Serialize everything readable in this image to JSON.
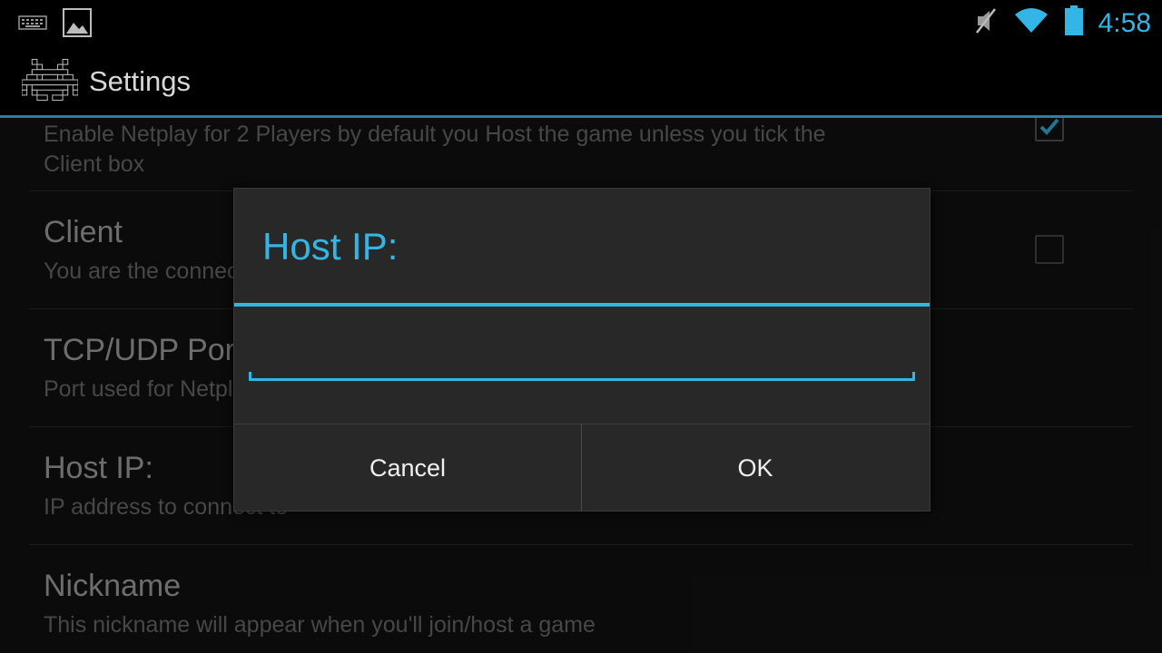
{
  "statusbar": {
    "time": "4:58",
    "icons": [
      "keyboard-icon",
      "image-icon",
      "mute-icon",
      "wifi-icon",
      "battery-icon"
    ]
  },
  "actionbar": {
    "title": "Settings",
    "app_icon": "space-invader-icon"
  },
  "preferences": [
    {
      "title": "",
      "summary": "Enable Netplay for 2 Players by default you Host the game unless you tick the",
      "summary_line2": "Client box",
      "checked": true
    },
    {
      "title": "Client",
      "summary": "You are the connecting",
      "checked": false
    },
    {
      "title": "TCP/UDP Port",
      "summary": "Port used for Netplay"
    },
    {
      "title": "Host IP:",
      "summary": "IP address to connect to"
    },
    {
      "title": "Nickname",
      "summary": "This nickname will appear when you'll join/host a game"
    }
  ],
  "dialog": {
    "title": "Host IP:",
    "input_value": "",
    "cancel_label": "Cancel",
    "ok_label": "OK"
  },
  "colors": {
    "accent": "#33b5e5",
    "background": "#121212"
  }
}
